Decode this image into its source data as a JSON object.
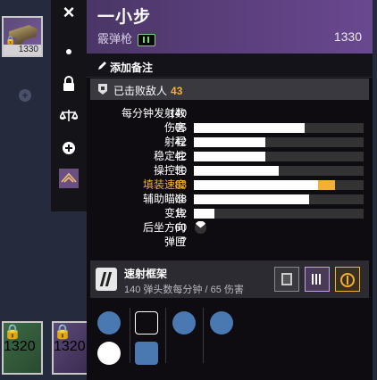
{
  "left_items": {
    "top_item_power": "1330",
    "bottom_item1_power": "1320",
    "bottom_item2_power": "1320"
  },
  "sidebar": {
    "close_label": "×"
  },
  "weapon": {
    "name": "一小步",
    "type": "霰弹枪",
    "power": "1330"
  },
  "notes": {
    "label": "添加备注"
  },
  "kills": {
    "label": "已击败敌人",
    "value": "43"
  },
  "stats": [
    {
      "label": "每分钟发射数",
      "value": "140"
    },
    {
      "label": "伤害",
      "value": "65",
      "fill": 0.65
    },
    {
      "label": "射程",
      "value": "42",
      "fill": 0.42
    },
    {
      "label": "稳定性",
      "value": "42",
      "fill": 0.42
    },
    {
      "label": "操控性",
      "value": "50",
      "fill": 0.5
    },
    {
      "label": "填装速度",
      "value": "83",
      "fill": 0.73,
      "bonus": 0.1,
      "highlight": true
    },
    {
      "label": "辅助瞄准",
      "value": "68",
      "fill": 0.68
    },
    {
      "label": "变焦",
      "value": "12",
      "fill": 0.12
    },
    {
      "label": "后坐方向",
      "value": "60"
    },
    {
      "label": "弹匣",
      "value": "7"
    }
  ],
  "frame": {
    "name": "速射框架",
    "description": "140 弹头数每分钟 / 65 伤害"
  },
  "colors": {
    "accent": "#f2b035",
    "header_purple": "#5e4080",
    "perk_blue": "#4a78b0"
  }
}
